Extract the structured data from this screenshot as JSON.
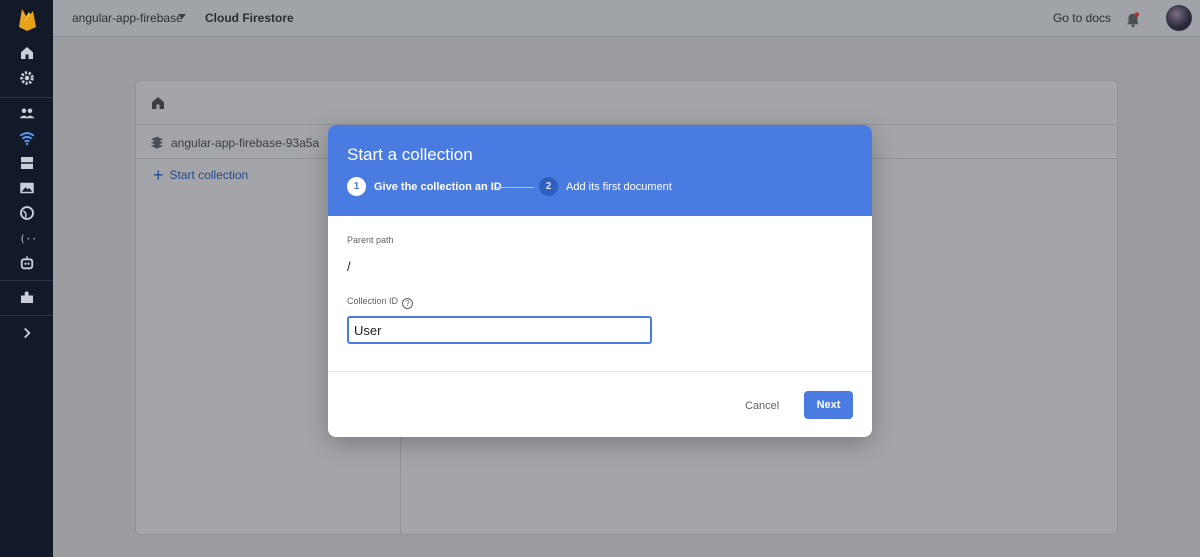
{
  "topbar": {
    "project_name": "angular-app-firebase",
    "product_name": "Cloud Firestore",
    "docs_link": "Go to docs"
  },
  "sidebar": {
    "items": [
      {
        "icon": "home-icon"
      },
      {
        "icon": "gear-icon"
      },
      {
        "icon": "users-icon"
      },
      {
        "icon": "firestore-icon"
      },
      {
        "icon": "database-icon"
      },
      {
        "icon": "storage-icon"
      },
      {
        "icon": "globe-icon"
      },
      {
        "icon": "functions-icon"
      },
      {
        "icon": "ml-robot-icon"
      },
      {
        "icon": "extensions-icon"
      },
      {
        "icon": "chevron-right-icon"
      }
    ]
  },
  "panel": {
    "collection_root": "angular-app-firebase-93a5a",
    "start_collection_label": "Start collection"
  },
  "dialog": {
    "title": "Start a collection",
    "steps": [
      {
        "number": "1",
        "label": "Give the collection an ID"
      },
      {
        "number": "2",
        "label": "Add its first document"
      }
    ],
    "parent_path_label": "Parent path",
    "parent_path_value": "/",
    "collection_id_label": "Collection ID",
    "collection_id_value": "User",
    "cancel_label": "Cancel",
    "next_label": "Next"
  },
  "colors": {
    "sidebar_bg": "#121a2a",
    "accent": "#4a7be0",
    "overlay_bg": "#9a9ca0"
  }
}
